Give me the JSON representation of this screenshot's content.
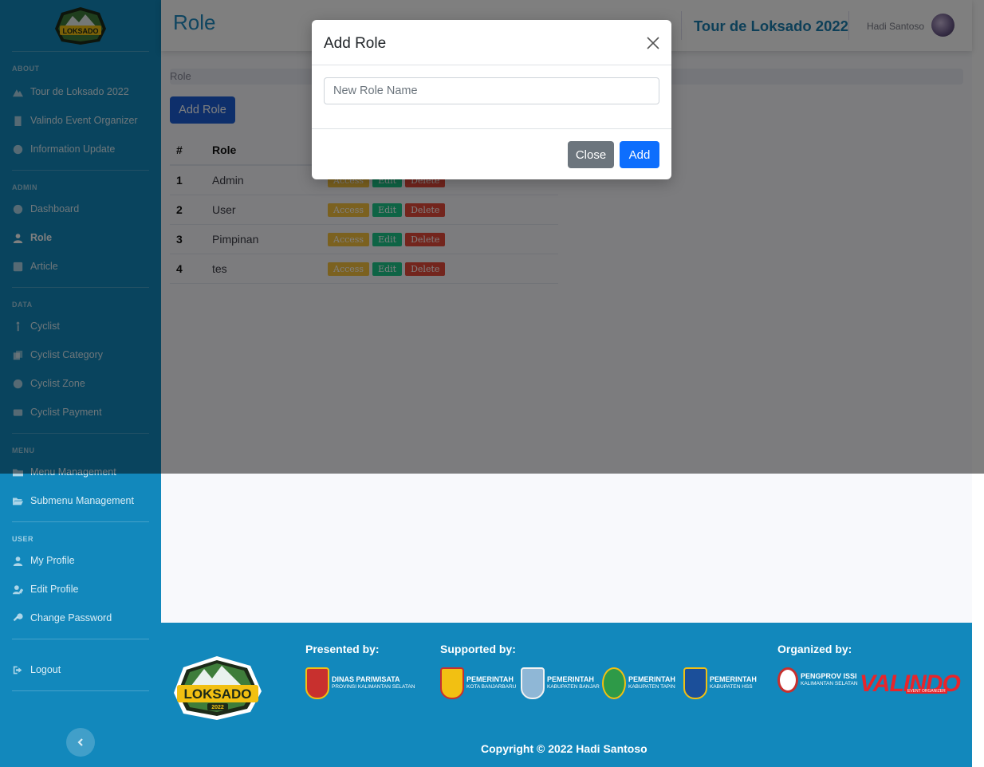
{
  "sidebar": {
    "sections": {
      "about": "About",
      "admin": "Admin",
      "data": "Data",
      "menu": "Menu",
      "user": "User"
    },
    "items": {
      "tour": "Tour de Loksado 2022",
      "organizer": "Valindo Event Organizer",
      "info_update": "Information Update",
      "dashboard": "Dashboard",
      "role": "Role",
      "article": "Article",
      "cyclist": "Cyclist",
      "cyclist_category": "Cyclist Category",
      "cyclist_zone": "Cyclist Zone",
      "cyclist_payment": "Cyclist Payment",
      "menu_management": "Menu Management",
      "submenu_management": "Submenu Management",
      "my_profile": "My Profile",
      "edit_profile": "Edit Profile",
      "change_password": "Change Password",
      "logout": "Logout"
    }
  },
  "topbar": {
    "page_title": "Role",
    "event_name": "Tour de Loksado 2022",
    "user_name": "Hadi Santoso"
  },
  "main": {
    "breadcrumb": "Role",
    "add_role_label": "Add Role",
    "table": {
      "headers": [
        "#",
        "Role"
      ],
      "rows": [
        {
          "num": "1",
          "role": "Admin"
        },
        {
          "num": "2",
          "role": "User"
        },
        {
          "num": "3",
          "role": "Pimpinan"
        },
        {
          "num": "4",
          "role": "tes"
        }
      ],
      "actions": {
        "access": "Access",
        "edit": "Edit",
        "delete": "Delete"
      }
    }
  },
  "modal": {
    "title": "Add Role",
    "input_placeholder": "New Role Name",
    "input_value": "",
    "close_label": "Close",
    "add_label": "Add"
  },
  "footer": {
    "presented_by": "Presented by:",
    "supported_by": "Supported by:",
    "organized_by": "Organized by:",
    "sponsors": {
      "dispar": {
        "title": "Dinas Pariwisata",
        "sub": "Provinsi Kalimantan Selatan"
      },
      "banjarbaru": {
        "title": "Pemerintah",
        "sub": "Kota Banjarbaru"
      },
      "banjar": {
        "title": "Pemerintah",
        "sub": "Kabupaten Banjar"
      },
      "tapin": {
        "title": "Pemerintah",
        "sub": "Kabupaten Tapin"
      },
      "hss": {
        "title": "Pemerintah",
        "sub": "Kabupaten HSS"
      },
      "issi": {
        "title": "Pengprov ISSI",
        "sub": "Kalimantan Selatan"
      }
    },
    "valindo": "VALINDO",
    "valindo_sub": "EVENT ORGANIZER",
    "copyright": "Copyright © 2022 Hadi Santoso"
  },
  "colors": {
    "sidebar_bg": "#1288bc",
    "primary": "#1d5fd6",
    "modal_add": "#0d6efd",
    "access": "#f6c23e",
    "edit": "#1cc88a",
    "delete": "#e74a3b"
  }
}
